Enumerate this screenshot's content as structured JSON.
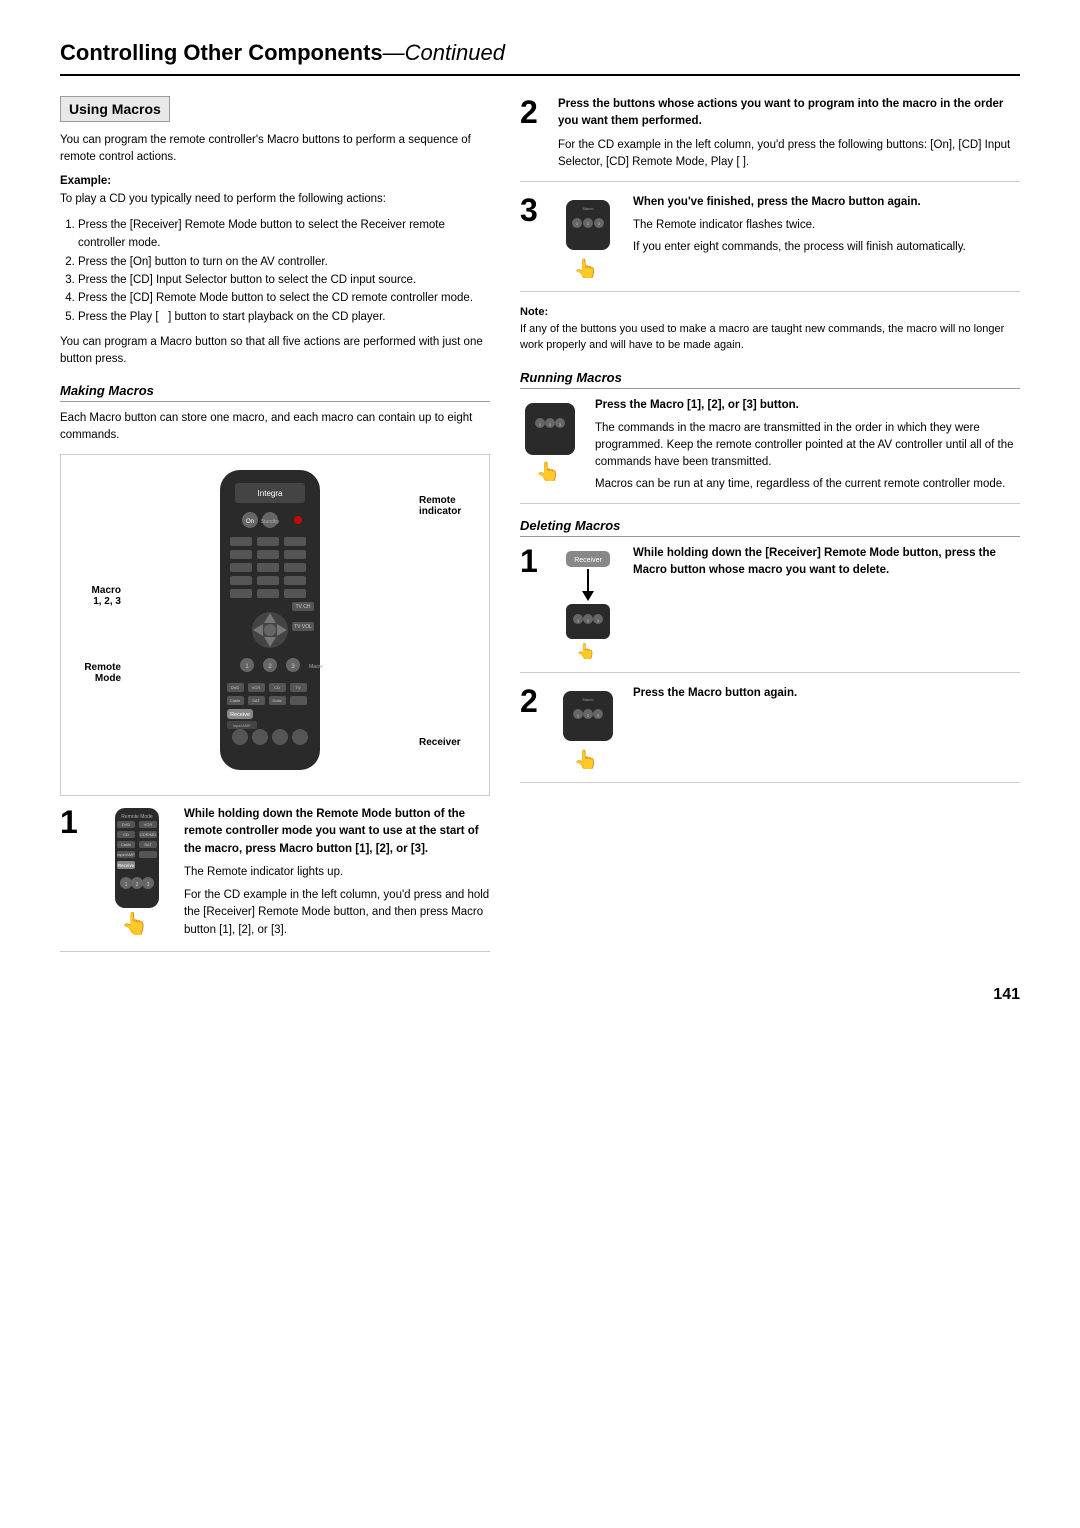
{
  "page": {
    "title": "Controlling Other Components",
    "title_continued": "—Continued",
    "page_number": "141"
  },
  "using_macros": {
    "section_title": "Using Macros",
    "intro": "You can program the remote controller's Macro buttons to perform a sequence of remote control actions.",
    "example_label": "Example:",
    "example_intro": "To play a CD you typically need to perform the following actions:",
    "steps": [
      "Press the [Receiver] Remote Mode button to select the Receiver remote controller mode.",
      "Press the [On] button to turn on the AV controller.",
      "Press the [CD] Input Selector button to select the CD input source.",
      "Press the [CD] Remote Mode button to select the CD remote controller mode.",
      "Press the Play [    ] button to start playback on the CD player."
    ],
    "outro": "You can program a Macro button so that all five actions are performed with just one button press."
  },
  "making_macros": {
    "title": "Making Macros",
    "intro": "Each Macro button can store one macro, and each macro can contain up to eight commands.",
    "labels": {
      "remote_indicator": "Remote\nindicator",
      "macro_123": "Macro\n1, 2, 3",
      "remote_mode": "Remote\nMode",
      "receiver": "Receiver"
    },
    "step1": {
      "number": "1",
      "bold_text": "While holding down the Remote Mode button of the remote controller mode you want to use at the start of the macro, press Macro button [1], [2], or [3].",
      "sub_text1": "The Remote indicator lights up.",
      "sub_text2": "For the CD example in the left column, you'd press and hold the [Receiver] Remote Mode button, and then press Macro button [1], [2], or [3]."
    }
  },
  "right_col": {
    "step2": {
      "number": "2",
      "bold_text": "Press the buttons whose actions you want to program into the macro in the order you want them performed.",
      "sub_text": "For the CD example in the left column, you'd press the following buttons: [On], [CD] Input Selector, [CD] Remote Mode, Play [    ]."
    },
    "step3": {
      "number": "3",
      "bold_text": "When you've finished, press the Macro button again.",
      "sub_text1": "The Remote indicator flashes twice.",
      "sub_text2": "If you enter eight commands, the process will finish automatically."
    },
    "note_label": "Note:",
    "note_text": "If any of the buttons you used to make a macro are taught new commands, the macro will no longer work properly and will have to be made again.",
    "running_macros": {
      "title": "Running Macros",
      "step_bold": "Press the Macro [1], [2], or [3] button.",
      "step_text": "The commands in the macro are transmitted in the order in which they were programmed. Keep the remote controller pointed at the AV controller until all of the commands have been transmitted.",
      "step_text2": "Macros can be run at any time, regardless of the current remote controller mode."
    },
    "deleting_macros": {
      "title": "Deleting Macros",
      "step1_number": "1",
      "step1_bold": "While holding down the [Receiver] Remote Mode button, press the Macro button whose macro you want to delete.",
      "step2_number": "2",
      "step2_bold": "Press the Macro button again."
    }
  }
}
